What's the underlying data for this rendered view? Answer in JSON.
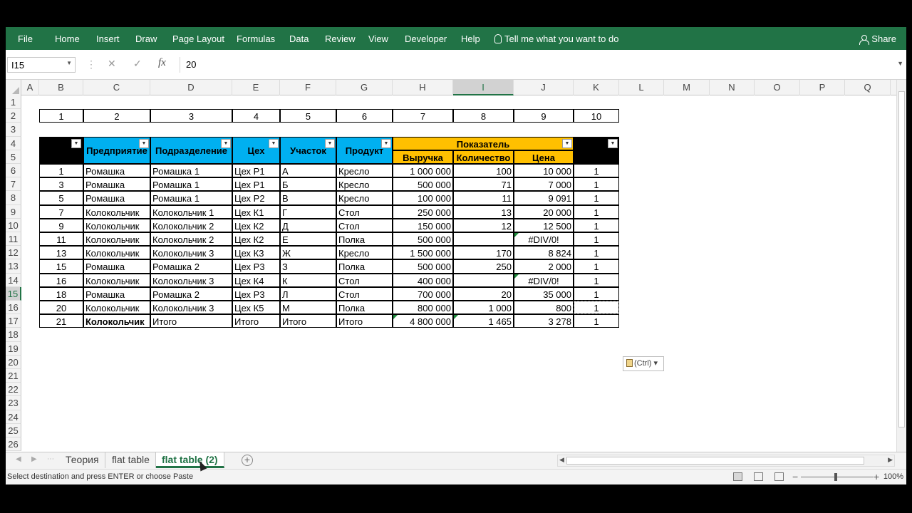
{
  "ribbon": {
    "file": "File",
    "tabs": [
      "Home",
      "Insert",
      "Draw",
      "Page Layout",
      "Formulas",
      "Data",
      "Review",
      "View",
      "Developer",
      "Help"
    ],
    "tell_me": "Tell me what you want to do",
    "share": "Share",
    "colors": {
      "ribbon_bg": "#217346"
    }
  },
  "formula_bar": {
    "name_box": "I15",
    "formula": "20",
    "fx": "fx"
  },
  "columns": [
    "A",
    "B",
    "C",
    "D",
    "E",
    "F",
    "G",
    "H",
    "I",
    "J",
    "K",
    "L",
    "M",
    "N",
    "O",
    "P",
    "Q"
  ],
  "selected_column": "I",
  "rows": [
    "1",
    "2",
    "3",
    "4",
    "5",
    "6",
    "7",
    "8",
    "9",
    "10",
    "11",
    "12",
    "13",
    "14",
    "15",
    "16",
    "17",
    "18",
    "19",
    "20",
    "21",
    "22",
    "23",
    "24",
    "25",
    "26"
  ],
  "selected_row": "15",
  "numbering_row": [
    "1",
    "2",
    "3",
    "4",
    "5",
    "6",
    "7",
    "8",
    "9",
    "10"
  ],
  "table": {
    "headers": {
      "enterprise": "Предприятие",
      "division": "Подразделение",
      "workshop": "Цех",
      "section": "Участок",
      "product": "Продукт",
      "indicator": "Показатель",
      "revenue": "Выручка",
      "quantity": "Количество",
      "price": "Цена"
    },
    "rows": [
      [
        "1",
        "Ромашка",
        "Ромашка 1",
        "Цех Р1",
        "А",
        "Кресло",
        "1 000 000",
        "100",
        "10 000",
        "1"
      ],
      [
        "3",
        "Ромашка",
        "Ромашка 1",
        "Цех Р1",
        "Б",
        "Кресло",
        "500 000",
        "71",
        "7 000",
        "1"
      ],
      [
        "5",
        "Ромашка",
        "Ромашка 1",
        "Цех Р2",
        "В",
        "Кресло",
        "100 000",
        "11",
        "9 091",
        "1"
      ],
      [
        "7",
        "Колокольчик",
        "Колокольчик 1",
        "Цех К1",
        "Г",
        "Стол",
        "250 000",
        "13",
        "20 000",
        "1"
      ],
      [
        "9",
        "Колокольчик",
        "Колокольчик 2",
        "Цех К2",
        "Д",
        "Стол",
        "150 000",
        "12",
        "12 500",
        "1"
      ],
      [
        "11",
        "Колокольчик",
        "Колокольчик 2",
        "Цех К2",
        "Е",
        "Полка",
        "500 000",
        "",
        "#DIV/0!",
        "1"
      ],
      [
        "13",
        "Колокольчик",
        "Колокольчик 3",
        "Цех К3",
        "Ж",
        "Кресло",
        "1 500 000",
        "170",
        "8 824",
        "1"
      ],
      [
        "15",
        "Ромашка",
        "Ромашка 2",
        "Цех Р3",
        "З",
        "Полка",
        "500 000",
        "250",
        "2 000",
        "1"
      ],
      [
        "16",
        "Колокольчик",
        "Колокольчик 3",
        "Цех К4",
        "К",
        "Стол",
        "400 000",
        "",
        "#DIV/0!",
        "1"
      ],
      [
        "18",
        "Ромашка",
        "Ромашка 2",
        "Цех Р3",
        "Л",
        "Стол",
        "700 000",
        "20",
        "35 000",
        "1"
      ],
      [
        "20",
        "Колокольчик",
        "Колокольчик 3",
        "Цех К5",
        "М",
        "Полка",
        "800 000",
        "1 000",
        "800",
        "1"
      ],
      [
        "21",
        "Колокольчик",
        "Итого",
        "Итого",
        "Итого",
        "Итого",
        "4 800 000",
        "1 465",
        "3 278",
        "1"
      ]
    ]
  },
  "paste_options": "(Ctrl)",
  "sheets": [
    "Теория",
    "flat table",
    "flat table (2)"
  ],
  "active_sheet": "flat table (2)",
  "status": {
    "message": "Select destination and press ENTER or choose Paste",
    "zoom": "100%"
  }
}
